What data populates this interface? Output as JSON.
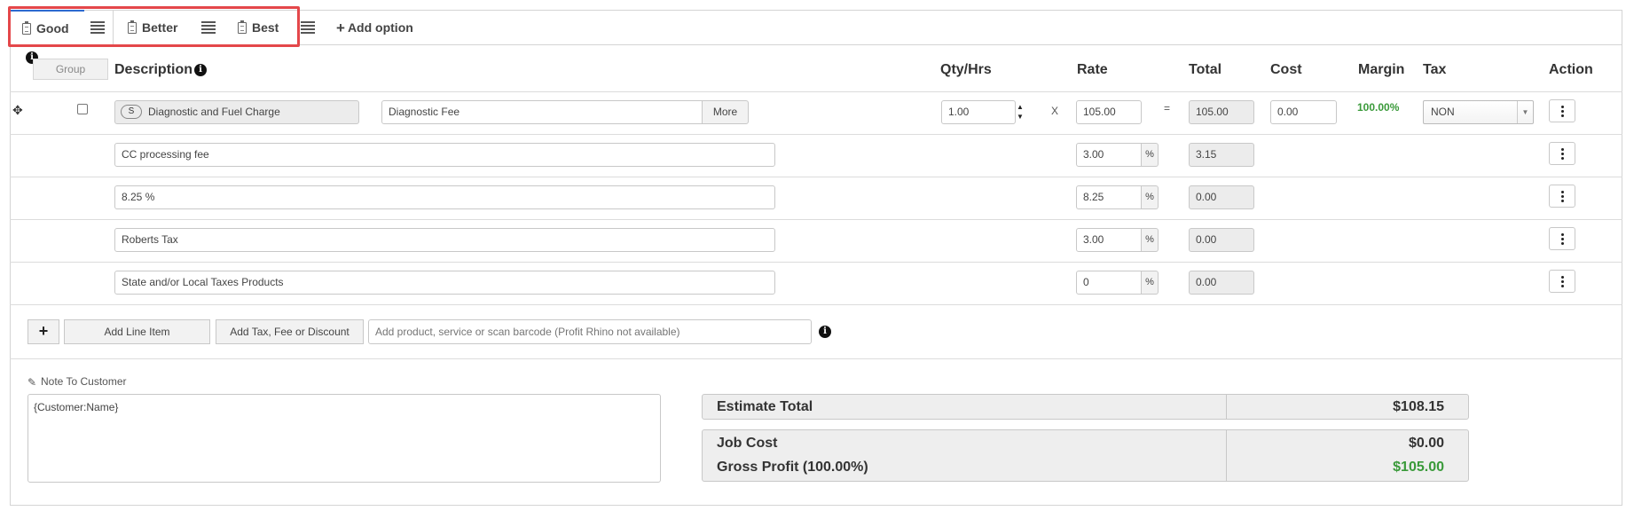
{
  "options": {
    "tabs": [
      {
        "label": "Good"
      },
      {
        "label": "Better"
      },
      {
        "label": "Best"
      }
    ],
    "add_option_label": "Add option"
  },
  "header": {
    "group_label": "Group",
    "description": "Description",
    "qty": "Qty/Hrs",
    "rate": "Rate",
    "total": "Total",
    "cost": "Cost",
    "margin": "Margin",
    "tax": "Tax",
    "action": "Action"
  },
  "info_glyph": "i",
  "line_item": {
    "badge": "S",
    "item_name": "Diagnostic and Fuel Charge",
    "description": "Diagnostic Fee",
    "more_label": "More",
    "qty": "1.00",
    "times": "X",
    "rate": "105.00",
    "equals": "=",
    "total": "105.00",
    "cost": "0.00",
    "margin": "100.00%",
    "tax": "NON"
  },
  "fee_rows": [
    {
      "description": "CC processing fee",
      "rate": "3.00",
      "unit": "%",
      "total": "3.15"
    },
    {
      "description": "8.25 %",
      "rate": "8.25",
      "unit": "%",
      "total": "0.00"
    },
    {
      "description": "Roberts Tax",
      "rate": "3.00",
      "unit": "%",
      "total": "0.00"
    },
    {
      "description": "State and/or Local Taxes Products",
      "rate": "0",
      "unit": "%",
      "total": "0.00"
    }
  ],
  "actions": {
    "plus": "+",
    "add_line_item": "Add Line Item",
    "add_tax_fee": "Add Tax, Fee or Discount",
    "search_placeholder": "Add product, service or scan barcode (Profit Rhino not available)"
  },
  "note": {
    "label": "Note To Customer",
    "value": "{Customer:Name}"
  },
  "summary": {
    "estimate_total_label": "Estimate Total",
    "estimate_total": "$108.15",
    "job_cost_label": "Job Cost",
    "job_cost": "$0.00",
    "gross_profit_label": "Gross Profit (100.00%)",
    "gross_profit": "$105.00"
  },
  "colors": {
    "accent_blue": "#2d6bd0",
    "highlight_red": "#e4474a",
    "profit_green": "#3a9a3a"
  }
}
